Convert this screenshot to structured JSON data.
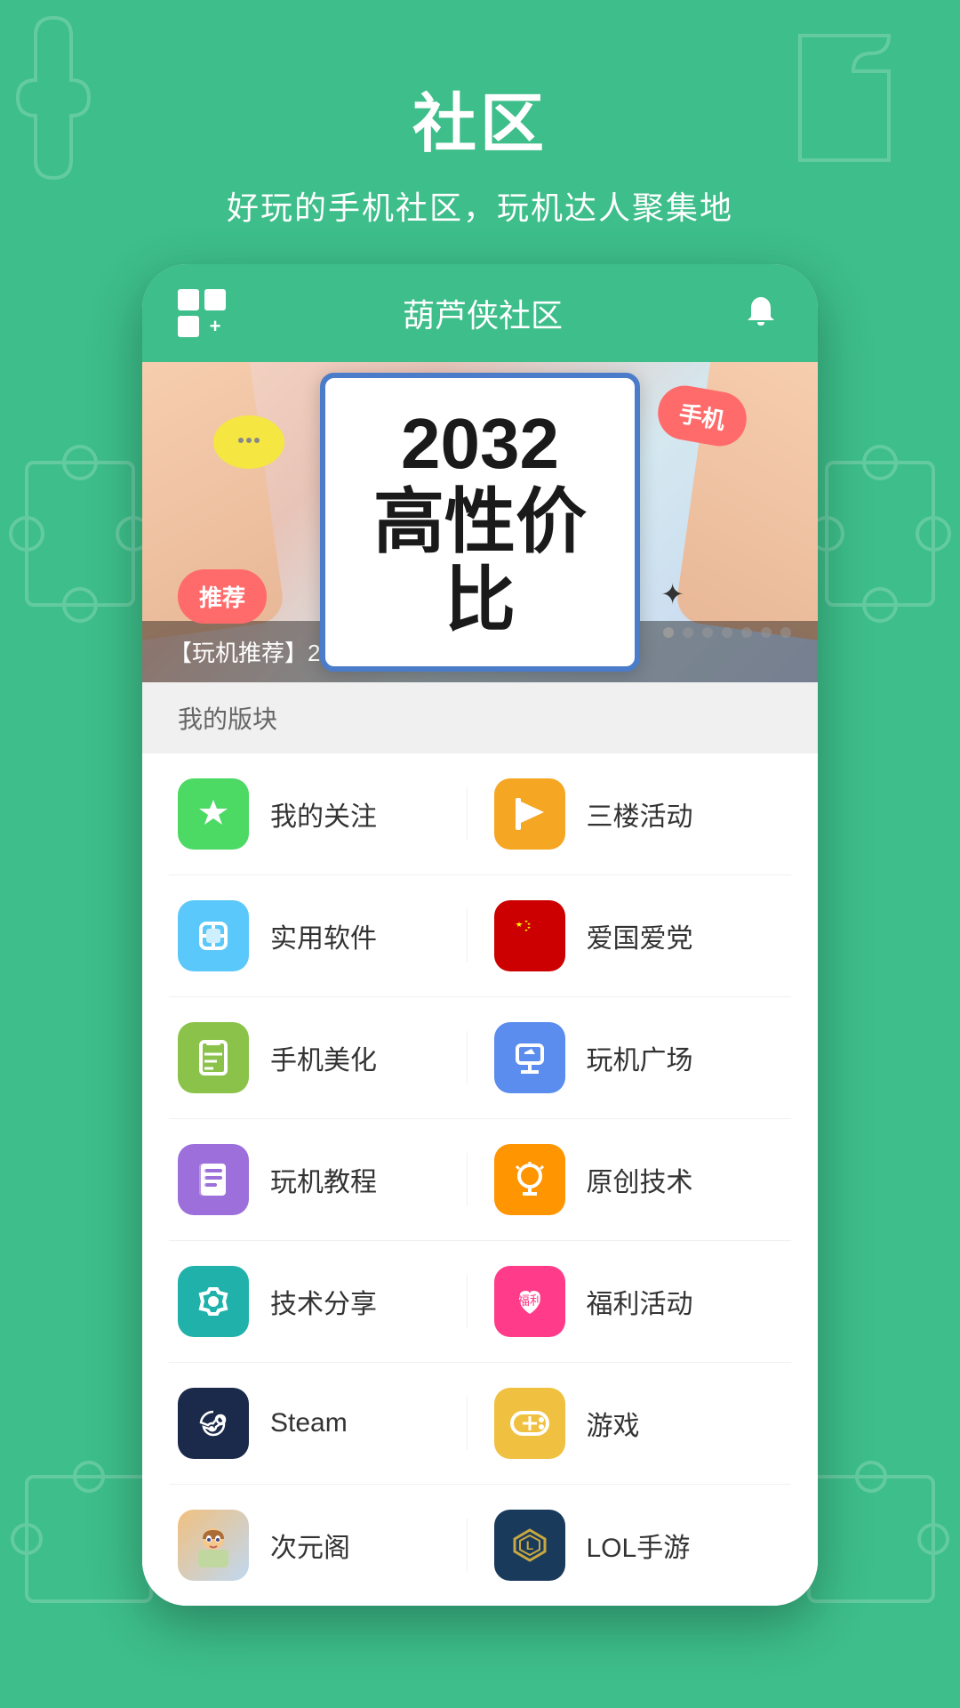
{
  "header": {
    "title": "社区",
    "subtitle": "好玩的手机社区，玩机达人聚集地"
  },
  "appbar": {
    "grid_label": "grid-plus-icon",
    "center_title": "葫芦侠社区",
    "bell_label": "bell-icon"
  },
  "banner": {
    "main_line1": "2032",
    "main_line2": "高性价比",
    "badge_tuijian": "推荐",
    "badge_shouji": "手机",
    "caption": "【玩机推荐】2023年2月高性价比手机推荐",
    "dots": [
      true,
      false,
      false,
      false,
      false,
      false,
      false
    ]
  },
  "my_sections": {
    "header": "我的版块",
    "rows": [
      {
        "left": {
          "icon_type": "star",
          "icon_bg": "green",
          "label": "我的关注"
        },
        "right": {
          "icon_type": "flag",
          "icon_bg": "yellow",
          "label": "三楼活动"
        }
      },
      {
        "left": {
          "icon_type": "box",
          "icon_bg": "cyan",
          "label": "实用软件"
        },
        "right": {
          "icon_type": "china-flag",
          "icon_bg": "red-flag",
          "label": "爱国爱党"
        }
      },
      {
        "left": {
          "icon_type": "book",
          "icon_bg": "lime",
          "label": "手机美化"
        },
        "right": {
          "icon_type": "phone-tilt",
          "icon_bg": "blue",
          "label": "玩机广场"
        }
      },
      {
        "left": {
          "icon_type": "bookmark-book",
          "icon_bg": "purple",
          "label": "玩机教程"
        },
        "right": {
          "icon_type": "lightbulb",
          "icon_bg": "orange",
          "label": "原创技术"
        }
      },
      {
        "left": {
          "icon_type": "wrench",
          "icon_bg": "teal",
          "label": "技术分享"
        },
        "right": {
          "icon_type": "gift-bag",
          "icon_bg": "pink",
          "label": "福利活动"
        }
      },
      {
        "left": {
          "icon_type": "steam",
          "icon_bg": "dark-blue",
          "label": "Steam"
        },
        "right": {
          "icon_type": "gamepad",
          "icon_bg": "gold",
          "label": "游戏"
        }
      },
      {
        "left": {
          "icon_type": "anime",
          "icon_bg": "anime",
          "label": "次元阁"
        },
        "right": {
          "icon_type": "lol",
          "icon_bg": "lol",
          "label": "LOL手游"
        }
      }
    ]
  }
}
